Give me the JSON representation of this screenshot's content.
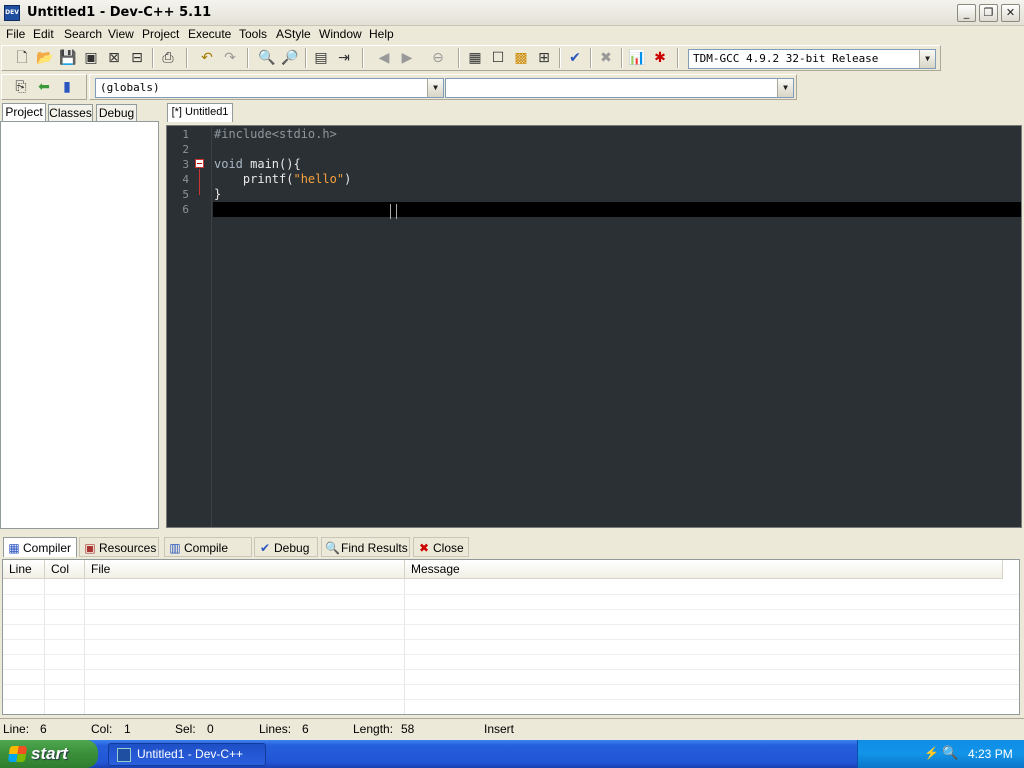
{
  "window": {
    "title": "Untitled1 - Dev-C++ 5.11",
    "app_icon_text": "DEV"
  },
  "menu": [
    "File",
    "Edit",
    "Search",
    "View",
    "Project",
    "Execute",
    "Tools",
    "AStyle",
    "Window",
    "Help"
  ],
  "toolbar": {
    "compiler_selected": "TDM-GCC 4.9.2 32-bit Release",
    "scope_selected": "(globals)",
    "symbol_selected": ""
  },
  "left_panel": {
    "tabs": [
      "Project",
      "Classes",
      "Debug"
    ]
  },
  "editor": {
    "tab_label": "[*] Untitled1",
    "line_numbers": [
      "1",
      "2",
      "3",
      "4",
      "5",
      "6"
    ],
    "lines": [
      {
        "text": "#include<stdio.h>"
      },
      {
        "text": ""
      },
      {
        "kw": "void",
        "rest": " main(){"
      },
      {
        "indent": "    ",
        "fn": "printf(",
        "str": "\"hello\"",
        "end": ")"
      },
      {
        "text": "}"
      },
      {
        "text": ""
      }
    ]
  },
  "bottom_panel": {
    "tabs": [
      "Compiler",
      "Resources",
      "Compile Log",
      "Debug",
      "Find Results",
      "Close"
    ],
    "columns": [
      "Line",
      "Col",
      "File",
      "Message"
    ]
  },
  "status": {
    "line_label": "Line:",
    "line_value": "6",
    "col_label": "Col:",
    "col_value": "1",
    "sel_label": "Sel:",
    "sel_value": "0",
    "lines_label": "Lines:",
    "lines_value": "6",
    "length_label": "Length:",
    "length_value": "58",
    "mode": "Insert"
  },
  "taskbar": {
    "start_label": "start",
    "task_label": "Untitled1 - Dev-C++",
    "clock": "4:23 PM"
  }
}
